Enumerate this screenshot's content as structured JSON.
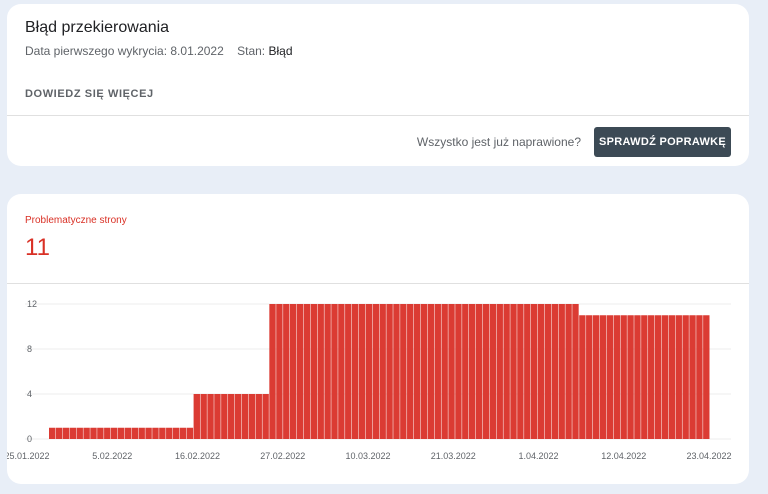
{
  "issue": {
    "title": "Błąd przekierowania",
    "first_detected_label": "Data pierwszego wykrycia: 8.01.2022",
    "status_label": "Stan:",
    "status_value": "Błąd",
    "learn_more": "DOWIEDZ SIĘ WIĘCEJ",
    "fixed_question": "Wszystko jest już naprawione?",
    "validate_button": "SPRAWDŹ POPRAWKĘ"
  },
  "summary": {
    "label": "Problematyczne strony",
    "count": "11"
  },
  "colors": {
    "accent": "#d93025",
    "bar": "#db3b33",
    "button": "#3c4a55"
  },
  "chart_data": {
    "type": "bar",
    "ylim": [
      0,
      12
    ],
    "yticks": [
      0,
      4,
      8,
      12
    ],
    "xtick_labels": [
      "25.01.2022",
      "5.02.2022",
      "16.02.2022",
      "27.02.2022",
      "10.03.2022",
      "21.03.2022",
      "1.04.2022",
      "12.04.2022",
      "23.04.2022"
    ],
    "x_start": "25.01.2022",
    "x_end": "23.04.2022",
    "series": [
      {
        "values": [
          1,
          1,
          1,
          1,
          1,
          1,
          1,
          1,
          1,
          1,
          1,
          1,
          1,
          1,
          1,
          1,
          1,
          1,
          1,
          1,
          1,
          4,
          4,
          4,
          4,
          4,
          4,
          4,
          4,
          4,
          4,
          4,
          12,
          12,
          12,
          12,
          12,
          12,
          12,
          12,
          12,
          12,
          12,
          12,
          12,
          12,
          12,
          12,
          12,
          12,
          12,
          12,
          12,
          12,
          12,
          12,
          12,
          12,
          12,
          12,
          12,
          12,
          12,
          12,
          12,
          12,
          12,
          12,
          12,
          12,
          12,
          12,
          12,
          12,
          12,
          12,
          12,
          11,
          11,
          11,
          11,
          11,
          11,
          11,
          11,
          11,
          11,
          11,
          11,
          11,
          11,
          11,
          11,
          11,
          11,
          11
        ]
      }
    ]
  }
}
